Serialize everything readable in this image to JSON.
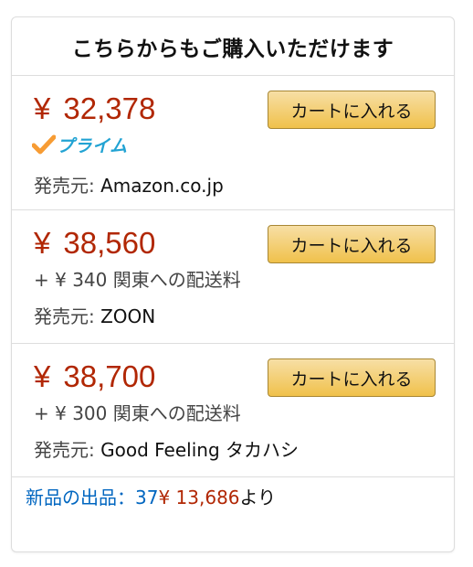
{
  "header": {
    "title": "こちらからもご購入いただけます"
  },
  "offers": [
    {
      "currency": "¥",
      "price": "32,378",
      "cart_label": "カートに入れる",
      "prime_label": "プライム",
      "seller_label": "発売元:",
      "seller_name": "Amazon.co.jp"
    },
    {
      "currency": "¥",
      "price": "38,560",
      "cart_label": "カートに入れる",
      "shipping": "+ ¥ 340 関東への配送料",
      "seller_label": "発売元:",
      "seller_name": "ZOON"
    },
    {
      "currency": "¥",
      "price": "38,700",
      "cart_label": "カートに入れる",
      "shipping": "+ ¥ 300 関東への配送料",
      "seller_label": "発売元:",
      "seller_name": "Good Feeling タカハシ"
    }
  ],
  "footer": {
    "new_offers_label": "新品の出品：",
    "new_offers_count": "37",
    "min_price": "¥ 13,686",
    "suffix": "より"
  },
  "colors": {
    "price": "#b12704",
    "link": "#0066c0",
    "prime": "#22a3d3",
    "prime_check": "#f79c34",
    "button_top": "#f7dfa5",
    "button_bottom": "#f0c14b"
  }
}
